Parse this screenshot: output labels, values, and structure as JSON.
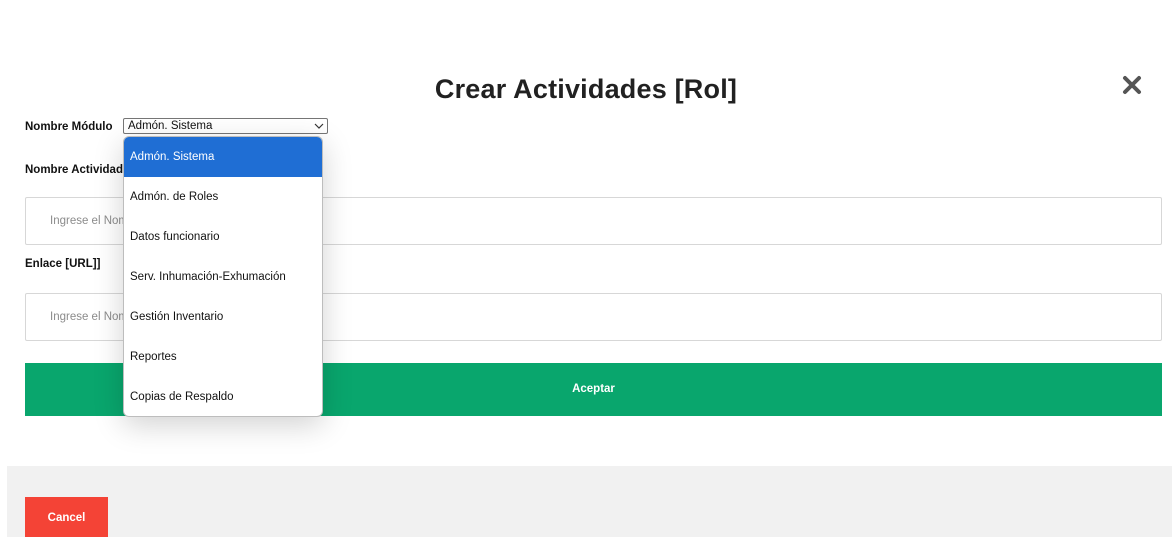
{
  "dialog": {
    "title": "Crear Actividades [Rol]",
    "close_icon": "close-x-icon"
  },
  "form": {
    "module_label": "Nombre Módulo",
    "module_selected": "Admón. Sistema",
    "activity_label": "Nombre Actividad",
    "activity_placeholder": "Ingrese el Nombre de la Actividad",
    "url_label": "Enlace [URL]]",
    "url_placeholder": "Ingrese el Nombre del Enlace",
    "accept_label": "Aceptar",
    "cancel_label": "Cancel"
  },
  "dropdown": {
    "options": [
      {
        "label": "Admón. Sistema",
        "selected": true
      },
      {
        "label": "Admón. de Roles",
        "selected": false
      },
      {
        "label": "Datos funcionario",
        "selected": false
      },
      {
        "label": "Serv. Inhumación-Exhumación",
        "selected": false
      },
      {
        "label": "Gestión Inventario",
        "selected": false
      },
      {
        "label": "Reportes",
        "selected": false
      },
      {
        "label": "Copias de Respaldo",
        "selected": false
      }
    ]
  },
  "colors": {
    "accept": "#09a66d",
    "cancel": "#f44336",
    "selected_option": "#1f6ed4",
    "footer": "#f1f1f1"
  }
}
